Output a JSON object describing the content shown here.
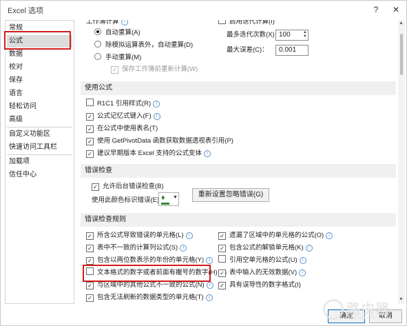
{
  "window": {
    "title": "Excel 选项",
    "help": "?",
    "close": "✕"
  },
  "sidebar": {
    "items": [
      {
        "label": "常规"
      },
      {
        "label": "公式"
      },
      {
        "label": "数据"
      },
      {
        "label": "校对"
      },
      {
        "label": "保存"
      },
      {
        "label": "语言"
      },
      {
        "label": "轻松访问"
      },
      {
        "label": "高级"
      },
      {
        "label": "自定义功能区"
      },
      {
        "label": "快速访问工具栏"
      },
      {
        "label": "加载项"
      },
      {
        "label": "信任中心"
      }
    ],
    "selected": "公式"
  },
  "calc": {
    "workbook_label": "工作簿计算",
    "auto": "自动重算(A)",
    "auto_except_tables": "除模拟运算表外，自动重算(D)",
    "manual": "手动重算(M)",
    "recalc_before_save": "保存工作簿前重新计算(W)",
    "enable_iterative": "启用迭代计算(I)",
    "max_iterations_label": "最多迭代次数(X)：",
    "max_iterations_value": "100",
    "max_change_label": "最大误差(C)：",
    "max_change_value": "0.001"
  },
  "formulas": {
    "header": "使用公式",
    "items": [
      {
        "label": "R1C1 引用样式(R)",
        "checked": false
      },
      {
        "label": "公式记忆式键入(F)",
        "checked": true
      },
      {
        "label": "在公式中使用表名(T)",
        "checked": true
      },
      {
        "label": "使用 GetPivotData 函数获取数据透视表引用(P)",
        "checked": true
      },
      {
        "label": "建议早期版本 Excel 支持的公式变体",
        "checked": true
      }
    ]
  },
  "error_checking": {
    "header": "错误检查",
    "enable_bg": "允许后台错误检查(B)",
    "color_label": "使用此颜色标识错误(E)：",
    "reset_button": "重新设置忽略错误(G)"
  },
  "rules": {
    "header": "错误检查规则",
    "left": [
      {
        "label": "所含公式导致错误的单元格(L)",
        "checked": true
      },
      {
        "label": "表中不一致的计算列公式(S)",
        "checked": true
      },
      {
        "label": "包含以两位数表示的年份的单元格(Y)",
        "checked": true
      },
      {
        "label": "文本格式的数字或者前面有撇号的数字(H)",
        "checked": false
      },
      {
        "label": "与区域中的其他公式不一致的公式(N)",
        "checked": true
      },
      {
        "label": "包含无法刷新的数据类型的单元格(T)",
        "checked": true
      }
    ],
    "right": [
      {
        "label": "遗漏了区域中的单元格的公式(O)",
        "checked": true
      },
      {
        "label": "包含公式的解锁单元格(K)",
        "checked": true
      },
      {
        "label": "引用空单元格的公式(U)",
        "checked": false
      },
      {
        "label": "表中输入的无效数据(V)",
        "checked": true
      },
      {
        "label": "具有误导性的数字格式(I)",
        "checked": true
      }
    ]
  },
  "footer": {
    "ok": "确定",
    "cancel": "取消"
  },
  "watermark": {
    "text": "路由器",
    "url": "luyouqi.com"
  },
  "colors": {
    "highlight": "#d21a1a",
    "accent": "#0067c0"
  }
}
